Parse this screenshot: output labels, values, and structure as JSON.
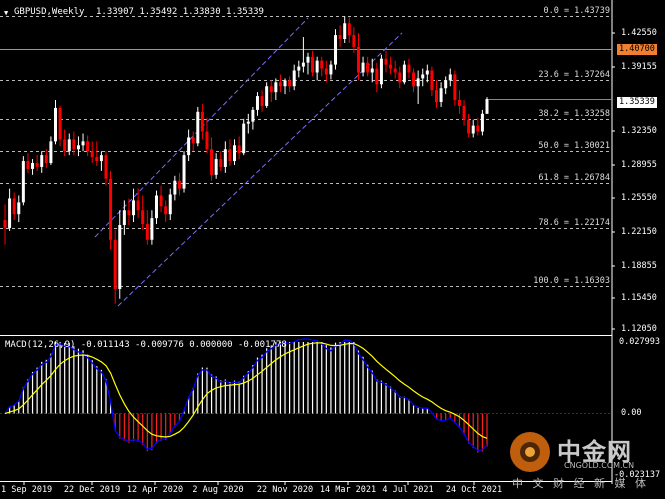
{
  "header": {
    "symbol_timeframe": "GBPUSD,Weekly",
    "ohlc": "1.33907 1.35492 1.33830 1.35339"
  },
  "price_axis": {
    "ticks": [
      "1.42550",
      "1.39155",
      "1.35339",
      "1.32350",
      "1.28955",
      "1.25550",
      "1.22150",
      "1.18855",
      "1.15450",
      "1.12050"
    ]
  },
  "current_price": {
    "label": "1.35339",
    "color": "#ffffff"
  },
  "horizontal_line": {
    "label": "1.40700",
    "color": "#f08030"
  },
  "fibonacci": {
    "color": "#bbbbbb",
    "levels": [
      {
        "label": "0.0 = 1.43739",
        "price": 1.43739
      },
      {
        "label": "23.6 = 1.37264",
        "price": 1.37264
      },
      {
        "label": "38.2 = 1.33258",
        "price": 1.33258
      },
      {
        "label": "50.0 = 1.30021",
        "price": 1.30021
      },
      {
        "label": "61.8 = 1.26784",
        "price": 1.26784
      },
      {
        "label": "78.6 = 1.22174",
        "price": 1.22174
      },
      {
        "label": "100.0 = 1.16303",
        "price": 1.16303
      }
    ]
  },
  "macd": {
    "label": "MACD(12,26,9) -0.011143 -0.009776 0.000000 -0.001778",
    "axis_ticks": [
      "0.027993",
      "0.00",
      "-0.023137"
    ],
    "signal_color": "#ffff00",
    "macd_color": "#0000ff"
  },
  "time_axis": {
    "labels": [
      "1 Sep 2019",
      "22 Dec 2019",
      "12 Apr 2020",
      "2 Aug 2020",
      "22 Nov 2020",
      "14 Mar 2021",
      "4 Jul 2021",
      "24 Oct 2021"
    ]
  },
  "watermark": {
    "brand": "中金网",
    "site": "CNGOLD.COM.CN",
    "tagline": "中 文 财 经 新 媒 体"
  },
  "chart_data": {
    "type": "candlestick",
    "title": "GBPUSD,Weekly",
    "colors": {
      "up": "#ffffff",
      "down": "#ff0000"
    },
    "candles": [
      [
        1.23,
        1.246,
        1.205,
        1.222
      ],
      [
        1.222,
        1.262,
        1.219,
        1.252
      ],
      [
        1.252,
        1.258,
        1.23,
        1.236
      ],
      [
        1.236,
        1.255,
        1.228,
        1.248
      ],
      [
        1.248,
        1.295,
        1.245,
        1.29
      ],
      [
        1.29,
        1.298,
        1.278,
        1.282
      ],
      [
        1.282,
        1.292,
        1.276,
        1.288
      ],
      [
        1.288,
        1.296,
        1.28,
        1.284
      ],
      [
        1.284,
        1.3,
        1.278,
        1.296
      ],
      [
        1.296,
        1.302,
        1.283,
        1.288
      ],
      [
        1.288,
        1.315,
        1.286,
        1.31
      ],
      [
        1.31,
        1.352,
        1.307,
        1.344
      ],
      [
        1.344,
        1.346,
        1.305,
        1.312
      ],
      [
        1.312,
        1.322,
        1.295,
        1.3
      ],
      [
        1.3,
        1.318,
        1.296,
        1.312
      ],
      [
        1.312,
        1.32,
        1.296,
        1.302
      ],
      [
        1.302,
        1.315,
        1.295,
        1.306
      ],
      [
        1.306,
        1.318,
        1.3,
        1.31
      ],
      [
        1.31,
        1.316,
        1.295,
        1.3
      ],
      [
        1.3,
        1.31,
        1.288,
        1.294
      ],
      [
        1.294,
        1.31,
        1.285,
        1.29
      ],
      [
        1.29,
        1.3,
        1.28,
        1.296
      ],
      [
        1.296,
        1.3,
        1.265,
        1.272
      ],
      [
        1.272,
        1.28,
        1.2,
        1.21
      ],
      [
        1.21,
        1.22,
        1.145,
        1.16
      ],
      [
        1.16,
        1.24,
        1.15,
        1.225
      ],
      [
        1.225,
        1.25,
        1.215,
        1.24
      ],
      [
        1.24,
        1.252,
        1.225,
        1.235
      ],
      [
        1.235,
        1.262,
        1.228,
        1.25
      ],
      [
        1.25,
        1.262,
        1.232,
        1.24
      ],
      [
        1.24,
        1.255,
        1.22,
        1.226
      ],
      [
        1.226,
        1.24,
        1.205,
        1.21
      ],
      [
        1.21,
        1.24,
        1.205,
        1.232
      ],
      [
        1.232,
        1.26,
        1.226,
        1.255
      ],
      [
        1.255,
        1.265,
        1.238,
        1.244
      ],
      [
        1.244,
        1.25,
        1.228,
        1.236
      ],
      [
        1.236,
        1.262,
        1.23,
        1.256
      ],
      [
        1.256,
        1.275,
        1.25,
        1.27
      ],
      [
        1.27,
        1.278,
        1.255,
        1.262
      ],
      [
        1.262,
        1.3,
        1.258,
        1.296
      ],
      [
        1.296,
        1.322,
        1.29,
        1.314
      ],
      [
        1.314,
        1.32,
        1.3,
        1.308
      ],
      [
        1.308,
        1.345,
        1.305,
        1.34
      ],
      [
        1.34,
        1.348,
        1.312,
        1.32
      ],
      [
        1.32,
        1.334,
        1.298,
        1.302
      ],
      [
        1.302,
        1.314,
        1.27,
        1.276
      ],
      [
        1.276,
        1.298,
        1.272,
        1.292
      ],
      [
        1.292,
        1.3,
        1.28,
        1.284
      ],
      [
        1.284,
        1.31,
        1.278,
        1.302
      ],
      [
        1.302,
        1.312,
        1.285,
        1.29
      ],
      [
        1.29,
        1.312,
        1.286,
        1.306
      ],
      [
        1.306,
        1.315,
        1.292,
        1.298
      ],
      [
        1.298,
        1.333,
        1.296,
        1.328
      ],
      [
        1.328,
        1.338,
        1.318,
        1.33
      ],
      [
        1.33,
        1.345,
        1.322,
        1.342
      ],
      [
        1.342,
        1.36,
        1.336,
        1.356
      ],
      [
        1.356,
        1.362,
        1.34,
        1.346
      ],
      [
        1.346,
        1.37,
        1.344,
        1.366
      ],
      [
        1.366,
        1.372,
        1.35,
        1.36
      ],
      [
        1.36,
        1.374,
        1.352,
        1.37
      ],
      [
        1.37,
        1.378,
        1.36,
        1.366
      ],
      [
        1.366,
        1.374,
        1.358,
        1.372
      ],
      [
        1.372,
        1.376,
        1.36,
        1.366
      ],
      [
        1.366,
        1.388,
        1.362,
        1.382
      ],
      [
        1.382,
        1.392,
        1.375,
        1.386
      ],
      [
        1.386,
        1.416,
        1.38,
        1.39
      ],
      [
        1.39,
        1.4,
        1.378,
        1.396
      ],
      [
        1.396,
        1.402,
        1.376,
        1.38
      ],
      [
        1.38,
        1.396,
        1.372,
        1.392
      ],
      [
        1.392,
        1.396,
        1.376,
        1.384
      ],
      [
        1.384,
        1.392,
        1.37,
        1.378
      ],
      [
        1.378,
        1.392,
        1.373,
        1.388
      ],
      [
        1.388,
        1.424,
        1.383,
        1.418
      ],
      [
        1.418,
        1.428,
        1.406,
        1.414
      ],
      [
        1.414,
        1.437,
        1.41,
        1.43
      ],
      [
        1.43,
        1.436,
        1.41,
        1.418
      ],
      [
        1.418,
        1.426,
        1.4,
        1.406
      ],
      [
        1.406,
        1.42,
        1.372,
        1.38
      ],
      [
        1.38,
        1.396,
        1.376,
        1.39
      ],
      [
        1.39,
        1.396,
        1.376,
        1.38
      ],
      [
        1.38,
        1.394,
        1.37,
        1.384
      ],
      [
        1.384,
        1.39,
        1.36,
        1.368
      ],
      [
        1.368,
        1.398,
        1.364,
        1.394
      ],
      [
        1.394,
        1.402,
        1.38,
        1.388
      ],
      [
        1.388,
        1.396,
        1.378,
        1.384
      ],
      [
        1.384,
        1.392,
        1.374,
        1.38
      ],
      [
        1.38,
        1.386,
        1.364,
        1.37
      ],
      [
        1.37,
        1.392,
        1.368,
        1.388
      ],
      [
        1.388,
        1.394,
        1.374,
        1.38
      ],
      [
        1.38,
        1.384,
        1.36,
        1.366
      ],
      [
        1.366,
        1.382,
        1.348,
        1.374
      ],
      [
        1.374,
        1.384,
        1.366,
        1.378
      ],
      [
        1.378,
        1.388,
        1.37,
        1.382
      ],
      [
        1.382,
        1.386,
        1.356,
        1.362
      ],
      [
        1.362,
        1.372,
        1.344,
        1.35
      ],
      [
        1.35,
        1.37,
        1.345,
        1.364
      ],
      [
        1.364,
        1.376,
        1.358,
        1.372
      ],
      [
        1.372,
        1.384,
        1.366,
        1.378
      ],
      [
        1.378,
        1.382,
        1.346,
        1.352
      ],
      [
        1.352,
        1.362,
        1.338,
        1.346
      ],
      [
        1.346,
        1.352,
        1.326,
        1.332
      ],
      [
        1.332,
        1.338,
        1.314,
        1.318
      ],
      [
        1.318,
        1.332,
        1.314,
        1.326
      ],
      [
        1.326,
        1.334,
        1.316,
        1.32
      ],
      [
        1.32,
        1.342,
        1.316,
        1.338
      ],
      [
        1.338,
        1.355,
        1.338,
        1.353
      ]
    ]
  }
}
